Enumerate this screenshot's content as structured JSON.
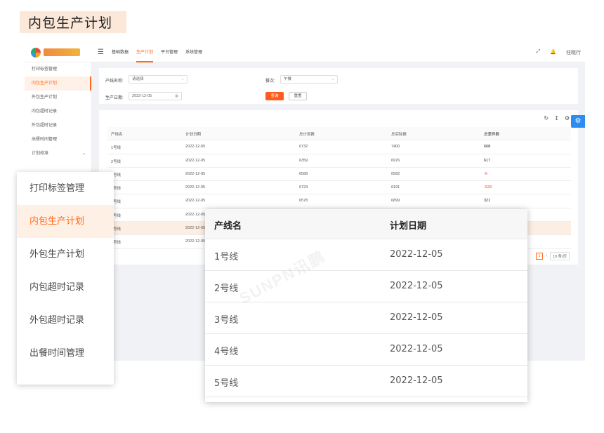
{
  "banner": {
    "title": "内包生产计划"
  },
  "app": {
    "topbar": {
      "nav": [
        "基础数据",
        "生产计划",
        "平台管理",
        "系统管理"
      ],
      "active_index": 1,
      "user": "任晓行"
    },
    "sidebar": {
      "items": [
        "打印标签管理",
        "内包生产计划",
        "外包生产计划",
        "内包超时记录",
        "外包超时记录",
        "出餐时间管理",
        "计划校准"
      ],
      "active_index": 1
    },
    "filters": {
      "line_label": "产线名称:",
      "line_placeholder": "请选择",
      "shift_label": "餐次:",
      "shift_value": "午餐",
      "date_label": "生产日期:",
      "date_value": "2022-12-05",
      "query_button": "查询",
      "reset_button": "重置"
    },
    "table": {
      "headers": [
        "产线名",
        "计划日期",
        "总计划数",
        "总实际数",
        "总差异数"
      ],
      "rows": [
        [
          "1号线",
          "2022-12-05",
          "6732",
          "7400",
          "668"
        ],
        [
          "2号线",
          "2022-12-05",
          "6359",
          "6976",
          "617"
        ],
        [
          "3号线",
          "2022-12-05",
          "6588",
          "6582",
          "-6"
        ],
        [
          "4号线",
          "2022-12-05",
          "6724",
          "6191",
          "-533"
        ],
        [
          "5号线",
          "2022-12-05",
          "6578",
          "6899",
          "321"
        ],
        [
          "6号线",
          "2022-12-05",
          "",
          "",
          ""
        ],
        [
          "7号线",
          "2022-12-05",
          "",
          "",
          ""
        ],
        [
          "8号线",
          "2022-12-05",
          "",
          "",
          ""
        ]
      ],
      "highlight_row": 6
    },
    "pager": {
      "current_page": "1",
      "page_size": "10 条/页"
    },
    "colors": {
      "accent": "#ff6a1a",
      "negative": "#f04134",
      "fab": "#2d8cf0"
    }
  },
  "zoom_sidebar": {
    "items": [
      "打印标签管理",
      "内包生产计划",
      "外包生产计划",
      "内包超时记录",
      "外包超时记录",
      "出餐时间管理",
      "计划校准"
    ],
    "active_index": 1
  },
  "zoom_table": {
    "headers": [
      "产线名",
      "计划日期"
    ],
    "rows": [
      [
        "1号线",
        "2022-12-05"
      ],
      [
        "2号线",
        "2022-12-05"
      ],
      [
        "3号线",
        "2022-12-05"
      ],
      [
        "4号线",
        "2022-12-05"
      ],
      [
        "5号线",
        "2022-12-05"
      ]
    ],
    "watermark": "SUNPN讯鹏"
  }
}
